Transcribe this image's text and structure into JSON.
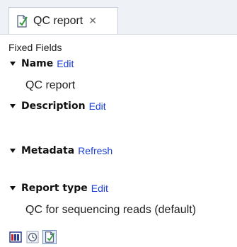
{
  "tab": {
    "title": "QC report",
    "close_glyph": "✕",
    "icon": "report-document-icon"
  },
  "section": {
    "title": "Fixed Fields"
  },
  "fields": [
    {
      "label": "Name",
      "action": "Edit",
      "value": "QC report"
    },
    {
      "label": "Description",
      "action": "Edit",
      "value": ""
    },
    {
      "label": "Metadata",
      "action": "Refresh",
      "value": ""
    },
    {
      "label": "Report type",
      "action": "Edit",
      "value": "QC for sequencing reads (default)"
    }
  ],
  "bottom_bar": {
    "buttons": [
      {
        "icon": "table-view-icon",
        "active": false
      },
      {
        "icon": "history-view-icon",
        "active": false
      },
      {
        "icon": "report-view-icon",
        "active": true
      }
    ]
  },
  "colors": {
    "link": "#1a3fd8",
    "tab_background": "#eef1f5",
    "text": "#1e1e1e"
  }
}
